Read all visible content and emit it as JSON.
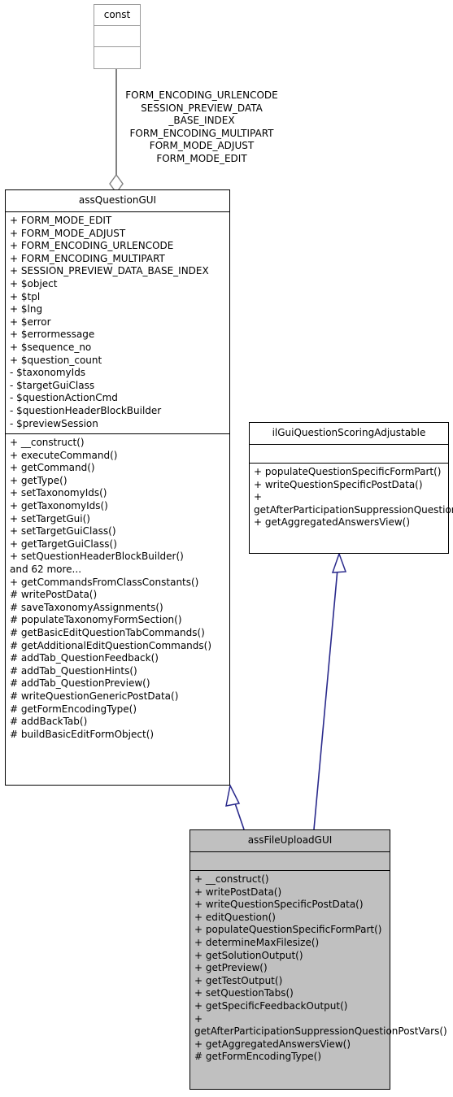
{
  "diagram": {
    "kind": "uml-class-diagram",
    "colors": {
      "background": "#ffffff",
      "box_border": "#000000",
      "light_box_border": "#9a9a9a",
      "filled_box_fill": "#c0c0c0",
      "inheritance_edge": "#2a2a8c",
      "aggregation_edge": "#808080",
      "text": "#000000"
    }
  },
  "const_box": {
    "title": "const",
    "attributes": [],
    "methods": []
  },
  "aggregation_edge": {
    "labels": "FORM_ENCODING_URLENCODE\nSESSION_PREVIEW_DATA\n_BASE_INDEX\nFORM_ENCODING_MULTIPART\nFORM_MODE_ADJUST\nFORM_MODE_EDIT"
  },
  "ass_question_gui": {
    "title": "assQuestionGUI",
    "attributes": [
      "+ FORM_MODE_EDIT",
      "+ FORM_MODE_ADJUST",
      "+ FORM_ENCODING_URLENCODE",
      "+ FORM_ENCODING_MULTIPART",
      "+ SESSION_PREVIEW_DATA_BASE_INDEX",
      "+ $object",
      "+ $tpl",
      "+ $lng",
      "+ $error",
      "+ $errormessage",
      "+ $sequence_no",
      "+ $question_count",
      "- $taxonomyIds",
      "- $targetGuiClass",
      "- $questionActionCmd",
      "- $questionHeaderBlockBuilder",
      "- $previewSession"
    ],
    "methods": [
      "+ __construct()",
      "+ executeCommand()",
      "+ getCommand()",
      "+ getType()",
      "+ setTaxonomyIds()",
      "+ getTaxonomyIds()",
      "+ setTargetGui()",
      "+ setTargetGuiClass()",
      "+ getTargetGuiClass()",
      "+ setQuestionHeaderBlockBuilder()",
      "and 62 more...",
      "+ getCommandsFromClassConstants()",
      "# writePostData()",
      "# saveTaxonomyAssignments()",
      "# populateTaxonomyFormSection()",
      "# getBasicEditQuestionTabCommands()",
      "# getAdditionalEditQuestionCommands()",
      "# addTab_QuestionFeedback()",
      "# addTab_QuestionHints()",
      "# addTab_QuestionPreview()",
      "# writeQuestionGenericPostData()",
      "# getFormEncodingType()",
      "# addBackTab()",
      "# buildBasicEditFormObject()"
    ]
  },
  "il_gui_question_scoring_adjustable": {
    "title": "ilGuiQuestionScoringAdjustable",
    "attributes": [],
    "methods": [
      "+ populateQuestionSpecificFormPart()",
      "+ writeQuestionSpecificPostData()",
      "+ getAfterParticipationSuppressionQuestionPostVars()",
      "+ getAggregatedAnswersView()"
    ]
  },
  "ass_file_upload_gui": {
    "title": "assFileUploadGUI",
    "attributes": [],
    "methods": [
      "+ __construct()",
      "+ writePostData()",
      "+ writeQuestionSpecificPostData()",
      "+ editQuestion()",
      "+ populateQuestionSpecificFormPart()",
      "+ determineMaxFilesize()",
      "+ getSolutionOutput()",
      "+ getPreview()",
      "+ getTestOutput()",
      "+ setQuestionTabs()",
      "+ getSpecificFeedbackOutput()",
      "+ getAfterParticipationSuppressionQuestionPostVars()",
      "+ getAggregatedAnswersView()",
      "# getFormEncodingType()"
    ]
  }
}
